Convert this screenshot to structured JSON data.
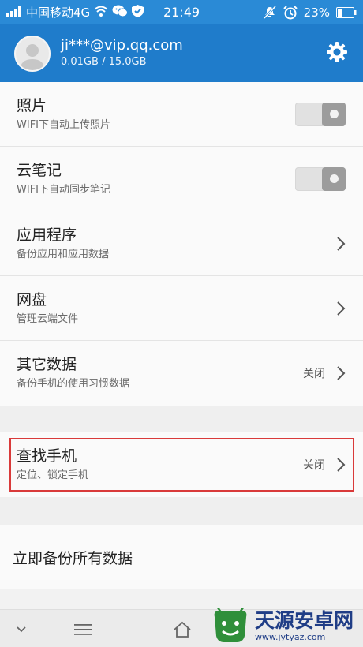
{
  "status_bar": {
    "carrier": "中国移动4G",
    "time": "21:49",
    "battery": "23%"
  },
  "account": {
    "email": "ji***@vip.qq.com",
    "storage": "0.01GB / 15.0GB"
  },
  "items": [
    {
      "title": "照片",
      "subtitle": "WIFI下自动上传照片",
      "control": "toggle"
    },
    {
      "title": "云笔记",
      "subtitle": "WIFI下自动同步笔记",
      "control": "toggle"
    },
    {
      "title": "应用程序",
      "subtitle": "备份应用和应用数据",
      "control": "chevron"
    },
    {
      "title": "网盘",
      "subtitle": "管理云端文件",
      "control": "chevron"
    },
    {
      "title": "其它数据",
      "subtitle": "备份手机的使用习惯数据",
      "value": "关闭",
      "control": "chevron"
    }
  ],
  "find_phone": {
    "title": "查找手机",
    "subtitle": "定位、锁定手机",
    "value": "关闭"
  },
  "backup_all": {
    "label": "立即备份所有数据"
  },
  "watermark": {
    "title": "天源安卓网",
    "url": "www.jytyaz.com"
  },
  "colors": {
    "header": "#1f7ccb",
    "status": "#2a8ad6",
    "highlight": "#d93a3a"
  },
  "icons": [
    "signal-icon",
    "wifi-icon",
    "wechat-icon",
    "shield-icon",
    "mute-icon",
    "alarm-icon",
    "battery-icon",
    "gear-icon",
    "chevron-right-icon",
    "chevron-down-icon",
    "menu-icon",
    "home-icon"
  ]
}
